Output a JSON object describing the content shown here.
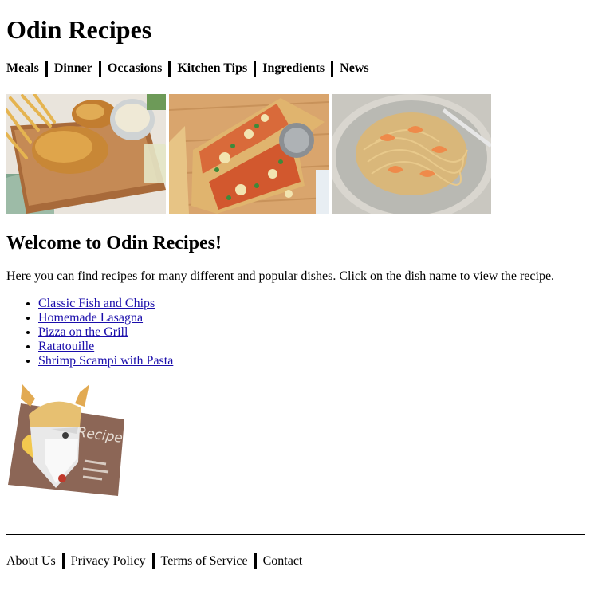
{
  "site": {
    "title": "Odin Recipes"
  },
  "nav": {
    "items": [
      {
        "label": "Meals"
      },
      {
        "label": "Dinner"
      },
      {
        "label": "Occasions"
      },
      {
        "label": "Kitchen Tips"
      },
      {
        "label": "Ingredients"
      },
      {
        "label": "News"
      }
    ]
  },
  "gallery": {
    "images": [
      {
        "icon": "fish-and-chips-photo"
      },
      {
        "icon": "pizza-photo"
      },
      {
        "icon": "shrimp-pasta-photo"
      }
    ]
  },
  "main": {
    "heading": "Welcome to Odin Recipes!",
    "intro": "Here you can find recipes for many different and popular dishes. Click on the dish name to view the recipe.",
    "recipes": [
      {
        "label": "Classic Fish and Chips"
      },
      {
        "label": "Homemade Lasagna"
      },
      {
        "label": "Pizza on the Grill"
      },
      {
        "label": "Ratatouille"
      },
      {
        "label": "Shrimp Scampi with Pasta"
      }
    ]
  },
  "logo": {
    "text": "Recipe"
  },
  "footer": {
    "links": [
      {
        "label": "About Us"
      },
      {
        "label": "Privacy Policy"
      },
      {
        "label": "Terms of Service"
      },
      {
        "label": "Contact"
      }
    ]
  },
  "colors": {
    "link": "#1a0dab",
    "text": "#000000",
    "background": "#ffffff"
  }
}
